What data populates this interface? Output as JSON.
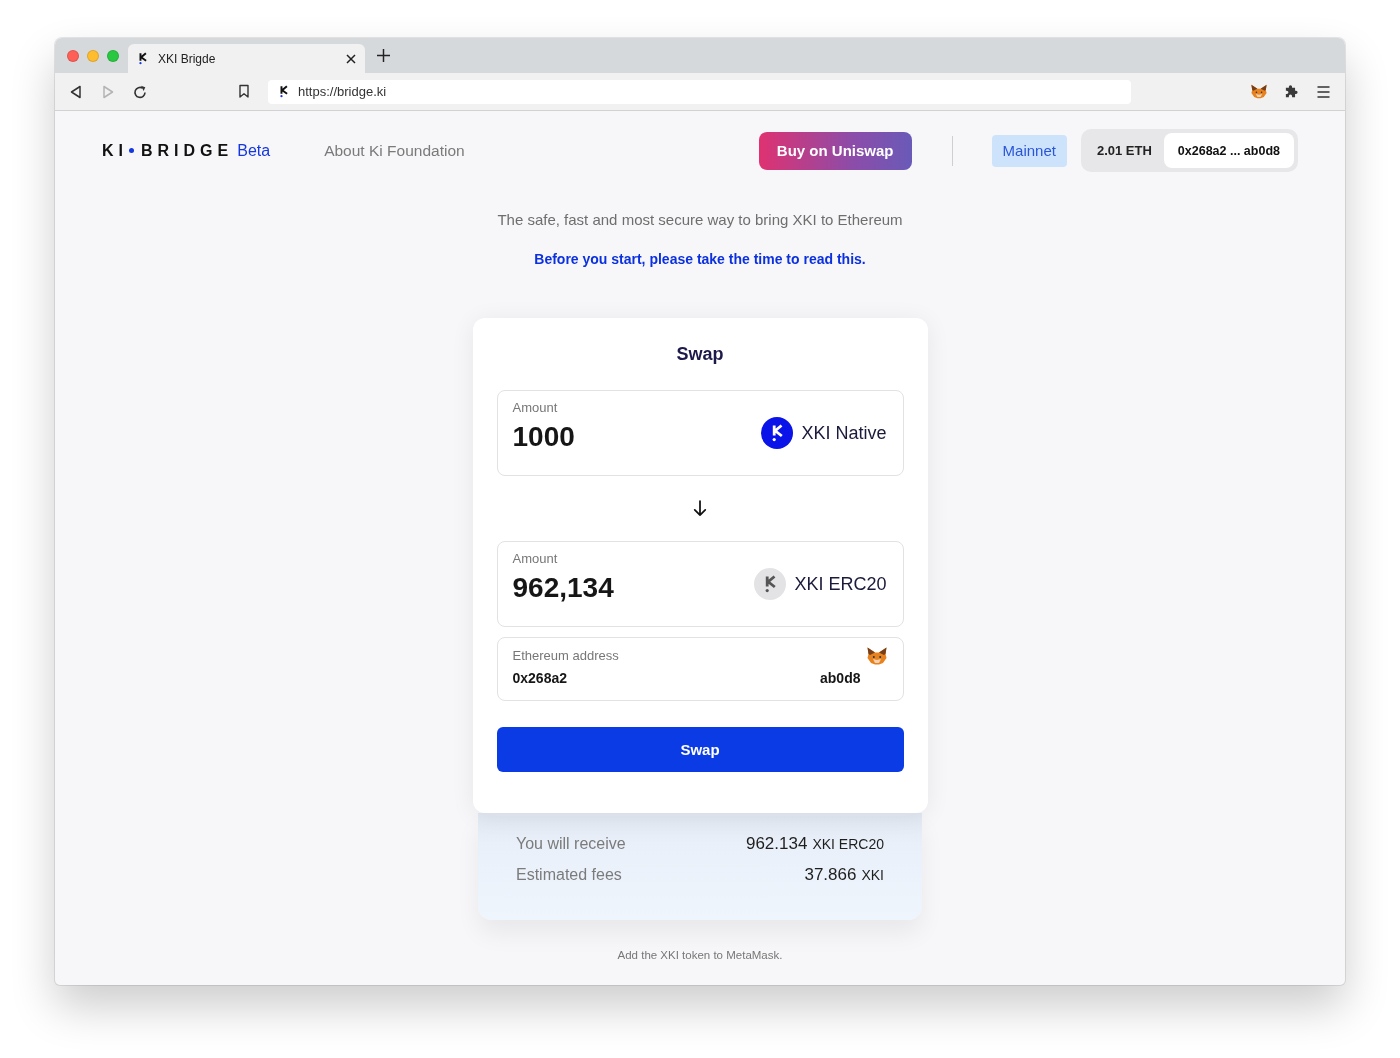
{
  "browser": {
    "tabs": [
      {
        "title": "XKI Brigde",
        "selected": true
      }
    ],
    "toolbar": {
      "back": {
        "disabled": false
      },
      "forward": {
        "disabled": true
      },
      "url": "https://bridge.ki"
    }
  },
  "header": {
    "logo": {
      "first": "KI",
      "second": "BRIDGE"
    },
    "badge": "Beta",
    "nav_link": "About Ki Foundation",
    "buy_button": "Buy on Uniswap",
    "network": "Mainnet",
    "wallet": {
      "balance": "2.01 ETH",
      "address": "0x268a2 ... ab0d8"
    }
  },
  "intro": {
    "tagline": "The safe, fast and most secure way to bring XKI to Ethereum",
    "notice_link": "Before you start, please take the time to read this."
  },
  "swap": {
    "title": "Swap",
    "amounts": [
      {
        "kind": "native",
        "label": "Amount",
        "value": "1000",
        "token": "XKI Native"
      },
      {
        "kind": "erc20",
        "label": "Amount",
        "value": "962,134",
        "token": "XKI ERC20"
      }
    ],
    "address": {
      "label": "Ethereum address",
      "start": "0x268a2",
      "end": "ab0d8"
    },
    "button": "Swap"
  },
  "summary": [
    {
      "label": "You will receive",
      "amount": "962.134",
      "unit": "XKI ERC20"
    },
    {
      "label": "Estimated fees",
      "amount": "37.866",
      "unit": "XKI"
    }
  ],
  "footer": {
    "link": "Add the XKI token to MetaMask."
  }
}
